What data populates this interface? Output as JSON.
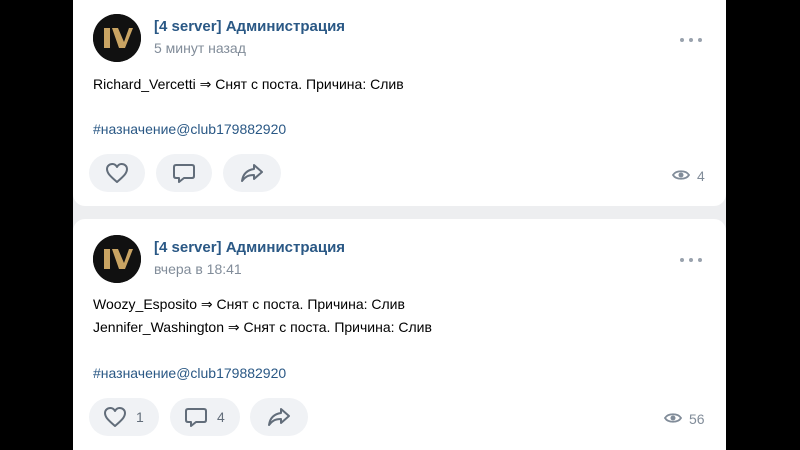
{
  "posts": [
    {
      "author": "[4 server] Администрация",
      "time": "5 минут назад",
      "lines": [
        "Richard_Vercetti ⇒ Снят с поста. Причина: Слив"
      ],
      "hashtag": "#назначение@club179882920",
      "likes": "",
      "comments": "",
      "views": "4"
    },
    {
      "author": "[4 server] Администрация",
      "time": "вчера в 18:41",
      "lines": [
        "Woozy_Esposito ⇒ Снят с поста. Причина: Слив",
        "Jennifer_Washington ⇒ Снят с поста. Причина: Слив"
      ],
      "hashtag": "#назначение@club179882920",
      "likes": "1",
      "comments": "4",
      "views": "56"
    }
  ],
  "icons": {
    "avatar": "group-logo-v-icon",
    "more": "more-dots-icon",
    "like": "heart-icon",
    "comment": "comment-bubble-icon",
    "share": "share-arrow-icon",
    "views": "eye-icon"
  },
  "colors": {
    "link": "#2a5885",
    "muted": "#818c99",
    "button_bg": "#f0f2f5",
    "feed_bg": "#edeef0",
    "logo_gold": "#c9a463"
  }
}
